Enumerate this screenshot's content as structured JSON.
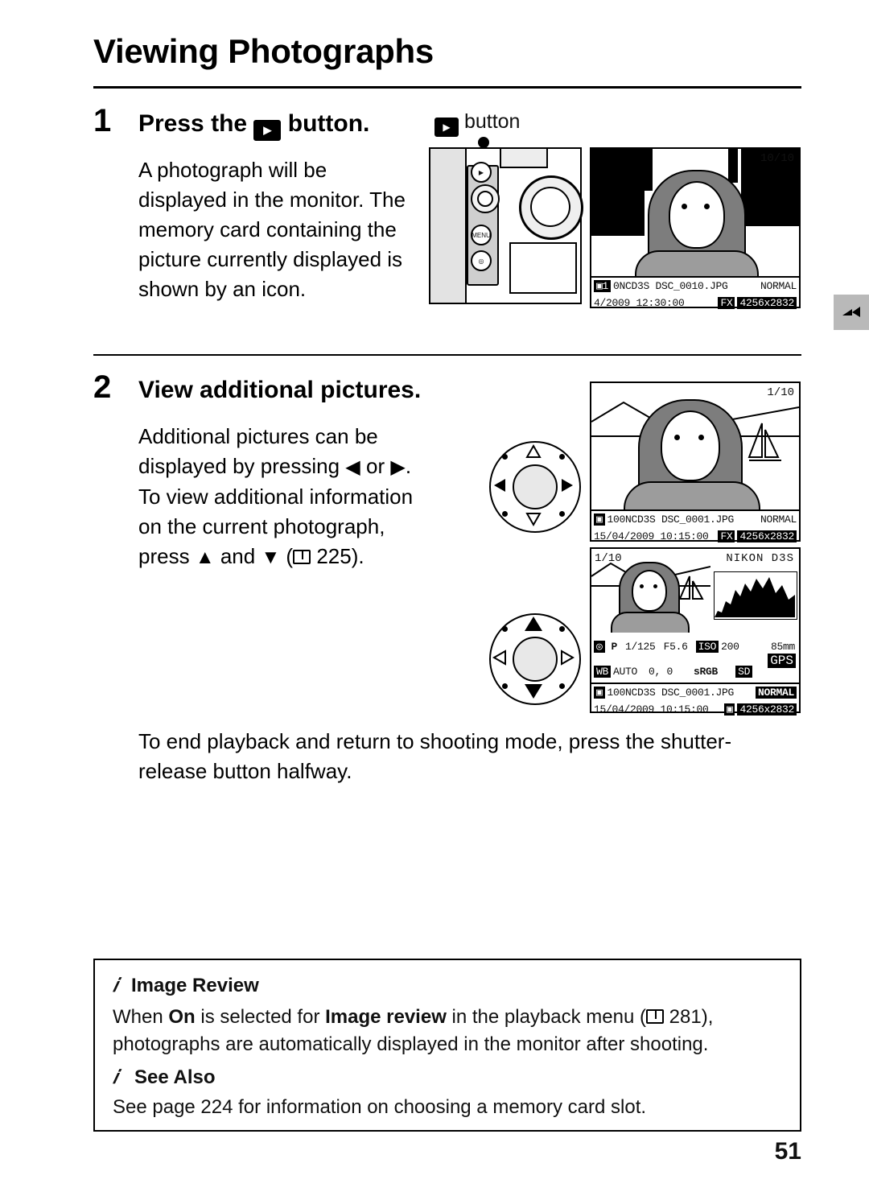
{
  "page": {
    "title": "Viewing Photographs",
    "number": "51"
  },
  "steps": [
    {
      "num": "1",
      "heading_prefix": "Press the",
      "heading_icon": "playback-button-icon",
      "heading_suffix": "button.",
      "body": "A photograph will be displayed in the monitor. The memory card containing the picture currently displayed is shown by an icon.",
      "callout": "button"
    },
    {
      "num": "2",
      "heading": "View additional pictures.",
      "body_line1": "Additional pictures can be",
      "body_line2_a": "displayed by pressing",
      "body_line2_left": "◀",
      "body_line2_or": "or",
      "body_line2_right": "▶",
      "body_line2_end": ".",
      "body_line3": "To view additional information",
      "body_line4": "on the current photograph,",
      "body_line5_a": "press",
      "body_line5_up": "▲",
      "body_line5_and": "and",
      "body_line5_down": "▼",
      "body_line5_ref": "225",
      "body_line5_end": ")."
    }
  ],
  "closing": "To end playback and return to shooting mode, press the shutter-release button halfway.",
  "monitors": [
    {
      "name": "playback-full-frame-first",
      "frame_counter": "10/10",
      "file_info": "0NCD3S DSC_0010.JPG",
      "quality": "NORMAL",
      "date": "4/2009 12:30:00",
      "format_tag": "FX",
      "size": "4256x2832",
      "slot_icon": "1"
    },
    {
      "name": "playback-full-frame-second",
      "frame_counter": "1/10",
      "file_info": "100NCD3S DSC_0001.JPG",
      "quality": "NORMAL",
      "date": "15/04/2009 10:15:00",
      "format_tag": "FX",
      "size": "4256x2832",
      "slot_icon": "1"
    },
    {
      "name": "playback-shooting-info",
      "frame_counter": "1/10",
      "camera": "NIKON D3S",
      "exposure_mode": "P",
      "shutter": "1/125",
      "aperture": "F5.6",
      "iso_label": "ISO",
      "iso": "200",
      "focal": "85mm",
      "wb_label": "WB",
      "wb": "AUTO",
      "wb_fine": "0, 0",
      "colorspace": "sRGB",
      "picture_control": "SD",
      "gps_label": "GPS",
      "file_info": "100NCD3S DSC_0001.JPG",
      "quality": "NORMAL",
      "date": "15/04/2009 10:15:00",
      "size": "4256x2832"
    }
  ],
  "notes": [
    {
      "icon": "pencil-icon",
      "title": "Image Review",
      "text_a": "When ",
      "text_on": "On",
      "text_b": " is selected for ",
      "text_item": "Image review",
      "text_c": " in the playback menu (",
      "text_ref": "281",
      "text_d": "),",
      "text_line2": "photographs are automatically displayed in the monitor after shooting."
    },
    {
      "icon": "pencil-icon",
      "title": "See Also",
      "text_line1": "See page 224 for information on choosing a memory card slot."
    }
  ]
}
